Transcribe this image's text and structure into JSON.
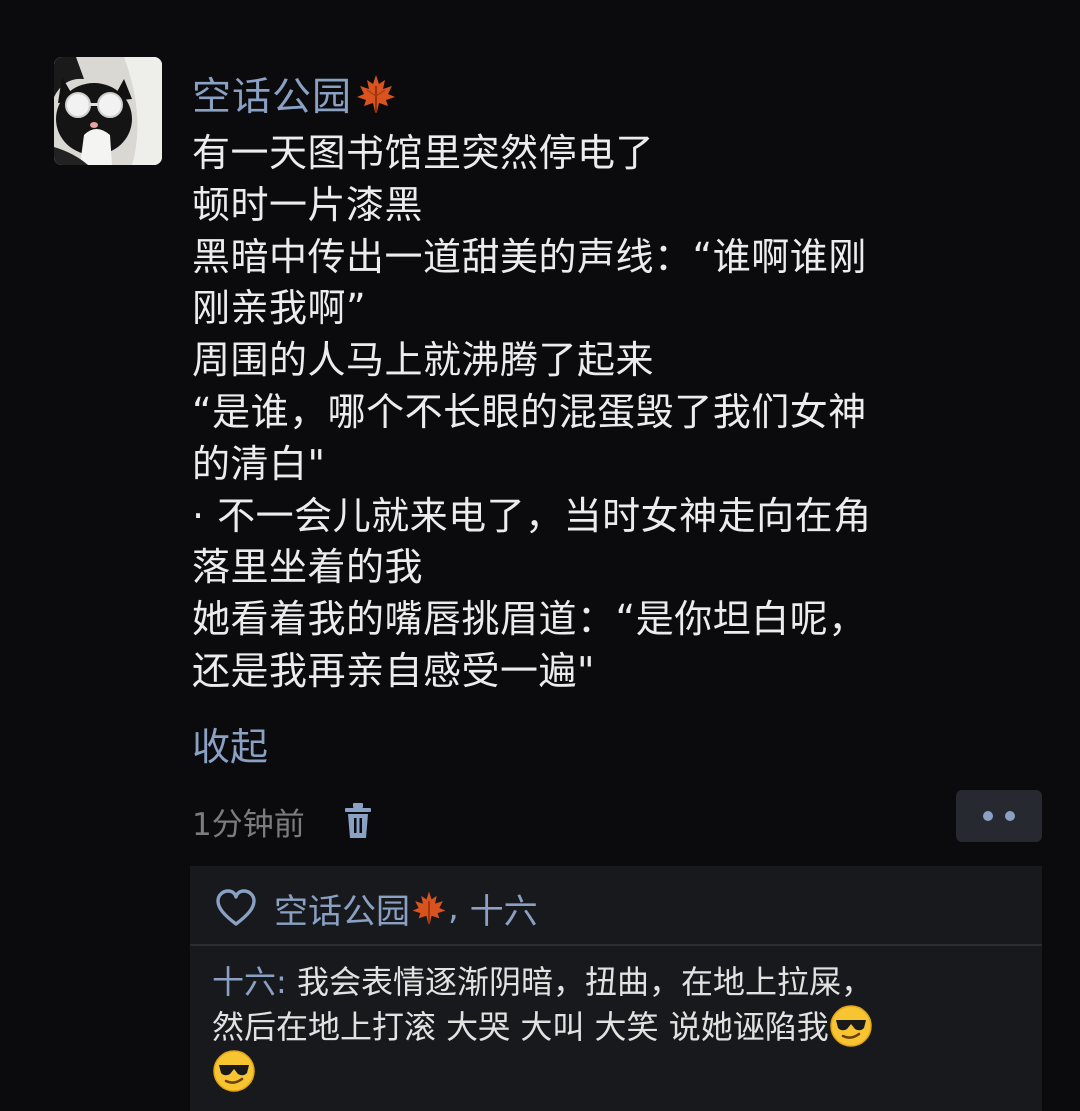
{
  "post": {
    "username": "空话公园",
    "username_emoji": "maple-leaf",
    "lines": [
      "有一天图书馆里突然停电了",
      "顿时一片漆黑",
      "黑暗中传出一道甜美的声线：“谁啊谁刚",
      "刚亲我啊”",
      "周围的人马上就沸腾了起来",
      "“是谁，哪个不长眼的混蛋毁了我们女神",
      "的清白\"",
      "· 不一会儿就来电了，当时女神走向在角",
      "落里坐着的我",
      "她看着我的嘴唇挑眉道：“是你坦白呢，",
      "还是我再亲自感受一遍\""
    ],
    "collapse_label": "收起",
    "timestamp": "1分钟前"
  },
  "likes": {
    "name1": "空话公园",
    "separator": ", ",
    "name2": "十六"
  },
  "comment": {
    "author": "十六",
    "colon": ": ",
    "line1": "我会表情逐渐阴暗，扭曲，在地上拉屎，",
    "line2": "然后在地上打滚 大哭 大叫 大笑 说她诬陷我",
    "emoji": "sunglasses-face"
  },
  "colors": {
    "background": "#0b0b0d",
    "link_blue": "#8aa1c4",
    "comment_bg": "#18191c",
    "text": "#ececec"
  }
}
